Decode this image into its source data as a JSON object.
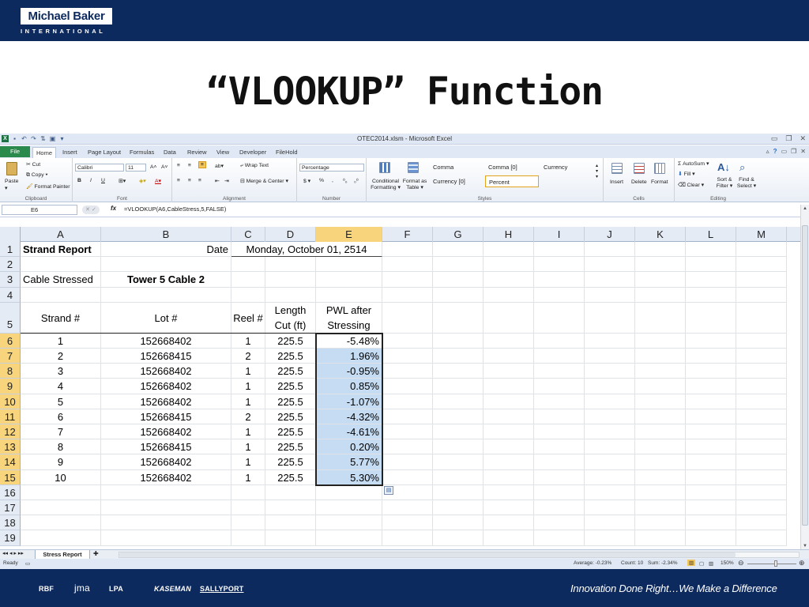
{
  "brand": {
    "name": "Michael Baker",
    "sub": "INTERNATIONAL"
  },
  "slide": {
    "title": "“VLOOKUP” Function"
  },
  "window": {
    "title": "OTEC2014.xlsm - Microsoft Excel"
  },
  "tabs": [
    "File",
    "Home",
    "Insert",
    "Page Layout",
    "Formulas",
    "Data",
    "Review",
    "View",
    "Developer",
    "FileHold"
  ],
  "ribbon": {
    "clipboard": {
      "paste": "Paste",
      "cut": "Cut",
      "copy": "Copy",
      "format_painter": "Format Painter",
      "label": "Clipboard"
    },
    "font": {
      "name": "Calibri",
      "size": "11",
      "label": "Font"
    },
    "alignment": {
      "wrap": "Wrap Text",
      "merge": "Merge & Center",
      "label": "Alignment"
    },
    "number": {
      "format": "Percentage",
      "label": "Number"
    },
    "styles": {
      "conditional": "Conditional Formatting ▾",
      "format_table": "Format as Table ▾",
      "cell_styles": [
        "Comma",
        "Comma [0]",
        "Currency",
        "Currency [0]",
        "Percent"
      ],
      "label": "Styles"
    },
    "cells": {
      "insert": "Insert",
      "delete": "Delete",
      "format": "Format",
      "label": "Cells"
    },
    "editing": {
      "autosum": "AutoSum",
      "fill": "Fill",
      "clear": "Clear",
      "sort": "Sort & Filter ▾",
      "find": "Find & Select ▾",
      "label": "Editing"
    }
  },
  "formula_bar": {
    "name_box": "E6",
    "formula": "=VLOOKUP(A6,CableStress,5,FALSE)"
  },
  "sheet": {
    "columns": [
      "A",
      "B",
      "C",
      "D",
      "E",
      "F",
      "G",
      "H",
      "I",
      "J",
      "K",
      "L",
      "M"
    ],
    "selected_column": "E",
    "selected_rows": [
      6,
      7,
      8,
      9,
      10,
      11,
      12,
      13,
      14,
      15
    ],
    "active_cell": "E6",
    "active_tab": "Stress Report",
    "rows": [
      {
        "n": 1,
        "cells": {
          "A": "Strand Report",
          "B": "Date",
          "C": "Monday, October 01, 2514"
        }
      },
      {
        "n": 2,
        "cells": {}
      },
      {
        "n": 3,
        "cells": {
          "A": "Cable Stressed",
          "B": "Tower 5 Cable 2"
        }
      },
      {
        "n": 4,
        "cells": {}
      },
      {
        "n": 5,
        "cells": {
          "A": "Strand #",
          "B": "Lot #",
          "C": "Reel #",
          "D": "Length\nCut (ft)",
          "E": "PWL after\nStressing"
        }
      },
      {
        "n": 6,
        "cells": {
          "A": "1",
          "B": "152668402",
          "C": "1",
          "D": "225.5",
          "E": "-5.48%"
        }
      },
      {
        "n": 7,
        "cells": {
          "A": "2",
          "B": "152668415",
          "C": "2",
          "D": "225.5",
          "E": "1.96%"
        }
      },
      {
        "n": 8,
        "cells": {
          "A": "3",
          "B": "152668402",
          "C": "1",
          "D": "225.5",
          "E": "-0.95%"
        }
      },
      {
        "n": 9,
        "cells": {
          "A": "4",
          "B": "152668402",
          "C": "1",
          "D": "225.5",
          "E": "0.85%"
        }
      },
      {
        "n": 10,
        "cells": {
          "A": "5",
          "B": "152668402",
          "C": "1",
          "D": "225.5",
          "E": "-1.07%"
        }
      },
      {
        "n": 11,
        "cells": {
          "A": "6",
          "B": "152668415",
          "C": "2",
          "D": "225.5",
          "E": "-4.32%"
        }
      },
      {
        "n": 12,
        "cells": {
          "A": "7",
          "B": "152668402",
          "C": "1",
          "D": "225.5",
          "E": "-4.61%"
        }
      },
      {
        "n": 13,
        "cells": {
          "A": "8",
          "B": "152668415",
          "C": "1",
          "D": "225.5",
          "E": "0.20%"
        }
      },
      {
        "n": 14,
        "cells": {
          "A": "9",
          "B": "152668402",
          "C": "1",
          "D": "225.5",
          "E": "5.77%"
        }
      },
      {
        "n": 15,
        "cells": {
          "A": "10",
          "B": "152668402",
          "C": "1",
          "D": "225.5",
          "E": "5.30%"
        }
      },
      {
        "n": 16,
        "cells": {}
      },
      {
        "n": 17,
        "cells": {}
      },
      {
        "n": 18,
        "cells": {}
      },
      {
        "n": 19,
        "cells": {}
      }
    ]
  },
  "status": {
    "ready": "Ready",
    "average": "Average: -0.23%",
    "count": "Count: 10",
    "sum": "Sum: -2.34%",
    "zoom": "150%"
  },
  "footer": {
    "partners": [
      "RBF",
      "jma",
      "LPA",
      "KASEMAN",
      "SALLYPORT"
    ],
    "tagline": "Innovation Done Right…We Make a Difference"
  }
}
